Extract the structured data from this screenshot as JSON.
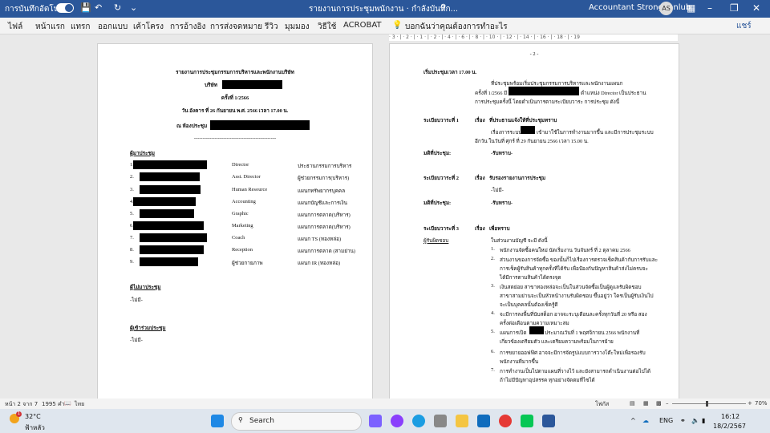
{
  "titlebar": {
    "autosave_label": "การบันทึกอัตโนมัติ",
    "document_title": "รายงานการประชุมพนักงาน · กำลังบันทึก...",
    "search_hint": "ค้นหา",
    "user_name": "Accountant Strongponlub",
    "avatar_initials": "AS"
  },
  "ribbon": {
    "tabs": [
      "ไฟล์",
      "หน้าแรก",
      "แทรก",
      "ออกแบบ",
      "เค้าโครง",
      "การอ้างอิง",
      "การส่งจดหมาย",
      "รีวิว",
      "มุมมอง",
      "วิธีใช้",
      "ACROBAT"
    ],
    "tell_me": "บอกฉันว่าคุณต้องการทำอะไร",
    "share_label": "แชร์"
  },
  "ruler_text": "· 3 · | · 2 · | · 1 · | · 2 · | · 4 · | · 6 · | · 8 · | · 10 · | · 12 · | · 14 · | · 16 · | · 18 · | · 19",
  "page1": {
    "title": "รายงานการประชุมกรรมการบริหารและพนักงานบริษัท",
    "company_label": "บริษัท",
    "meeting_no": "ครั้งที่ 1/2566",
    "datetime": "วัน อังคาร ที่ 26 กันยายน พ.ศ. 2566 เวลา 17.00 น.",
    "room_label": "ณ ห้องประชุม",
    "divider": "------------------------------------------------",
    "attendees_heading": "ผู้มาประชุม",
    "attendees": [
      {
        "no": "1.",
        "role": "Director",
        "dept": "ประธานกรรมการบริหาร"
      },
      {
        "no": "2.",
        "role": "Asst. Director",
        "dept": "ผู้ช่วยกรรมการ(บริหาร)"
      },
      {
        "no": "3.",
        "role": "Human Resource",
        "dept": "แผนกทรัพยากรบุคคล"
      },
      {
        "no": "4.",
        "role": "Accounting",
        "dept": "แผนกบัญชีและการเงิน"
      },
      {
        "no": "5.",
        "role": "Graphic",
        "dept": "แผนกการตลาด(บริหาร)"
      },
      {
        "no": "6.",
        "role": "Marketing",
        "dept": "แผนกการตลาด(บริหาร)"
      },
      {
        "no": "7.",
        "role": "Coach",
        "dept": "แผนก TS (ทองหล่อ)"
      },
      {
        "no": "8.",
        "role": "Reception",
        "dept": "แผนกการตลาด (สามย่าน)"
      },
      {
        "no": "9.",
        "role": "ผู้ช่วยกายภาพ",
        "dept": "แผนก IR (ทองหล่อ)"
      }
    ],
    "absent_heading": "ผู้ไม่มาประชุม",
    "absent_value": "-ไม่มี-",
    "guests_heading": "ผู้เข้าร่วมประชุม",
    "guests_value": "-ไม่มี-"
  },
  "page2": {
    "page_no": "- 2 -",
    "start_time": "เริ่มประชุมเวลา 17.00 น.",
    "intro": [
      "ที่ประชุมพร้อมเริ่มประชุมกรรมการบริหารและพนักงานแผนก",
      "ครั้งที่ 1/2566 มี",
      "ตำแหน่ง Director เป็นประธาน",
      "การประชุมครั้งนี้ โดยดำเนินการตามระเบียบวาระ การประชุม ดังนี้"
    ],
    "agenda": [
      {
        "title": "ระเบียบวาระที่ 1",
        "subject_label": "เรื่อง",
        "subject": "ที่ประธานแจ้งให้ที่ประชุมทราบ",
        "body": [
          "เรื่องการระบบ",
          "เข้ามาใช้ในการทำงานมากขึ้น และมีการประชุมระบบ",
          "อีกวัน ในวันที่ ศุกร์ ที่ 29 กันยายน 2566 เวลา 15.00 น."
        ],
        "resolution_label": "มติที่ประชุม:",
        "resolution": "-รับทราบ-"
      },
      {
        "title": "ระเบียบวาระที่ 2",
        "subject_label": "เรื่อง",
        "subject": "รับรองรายงานการประชุม",
        "body": [
          "-ไม่มี-"
        ],
        "resolution_label": "มติที่ประชุม:",
        "resolution": "-รับทราบ-"
      },
      {
        "title": "ระเบียบวาระที่ 3",
        "subject_label": "เรื่อง",
        "subject": "เพื่อทราบ"
      }
    ],
    "detail_label": "ผู้รับผิดชอบ",
    "detail_intro": "ในส่วนงานบัญชี จะมี ดังนี้",
    "items": [
      [
        "1.",
        "พนักงานจัดซื้อคนใหม่ นัดเริ่มงาน วันจันทร์ ที่ 2 ตุลาคม 2566"
      ],
      [
        "2.",
        "ส่วนงานของการจัดซื้อ ของนั้นก็ไปเรื่องการตรวจเช็คสินค้ากับการรับและ",
        "การเช็คผู้รับสินค้าทุกครั้งที่ได้รับ เพื่อป้องกันปัญหาสินค้าส่งไม่ครบจะ",
        "ได้มีการตามสินค้าได้ตรงจุด"
      ],
      [
        "3.",
        "เงินสดย่อย สาขาทองหล่อจะเป็นในส่วนจัดซื้อเป็นผู้ดูแลรับผิดชอบ",
        "สาขาสามย่านจะเป็นหัวหน้างานรับผิดชอบ ขึ้นอยู่ว่า ใครเป็นผู้รับเงินไป",
        "จะเป็นบุคคลนั้นต้องเช็ครู้ดี"
      ],
      [
        "4.",
        "จะมีการลงพื้นที่นับสต็อก อาจจะระบุเดือนละครั้งทุกวันที่ 20 หรือ สอง",
        "ครั้งต่อเดือนตามความเหมาะสม"
      ],
      [
        "5.",
        "แผนการเปิด",
        "ประมาณวันที่ 1 พฤศจิกายน 2566 พนักงานที่",
        "เกี่ยวข้องเตรียมตัว และเตรียมความพร้อมในการย้าย"
      ],
      [
        "6.",
        "การขยายออฟฟิศ อาจจะมีการจัดรูปแบบการวางโต๊ะใหม่เพื่อรองรับ",
        "พนักงานที่มากขึ้น"
      ],
      [
        "7.",
        "การทำงานเป็นไปตามแผนที่วางไว้ และยังสามารถดำเนินงานต่อไปได้",
        "ถ้าไม่มีปัญหาอุปสรรค ทุกอย่างจัดตมที่ไซได้"
      ]
    ]
  },
  "statusbar": {
    "page_info": "หน้า 2 จาก 7",
    "word_count": "1995 คำ",
    "focus": "โฟกัส",
    "zoom": "70%",
    "tools": "ไทย"
  },
  "taskbar": {
    "temperature": "32°C",
    "weather_text": "ฟ้าหลัว",
    "weather_badge": "1",
    "search_placeholder": "Search",
    "language": "ENG",
    "time": "16:12",
    "date": "18/2/2567"
  }
}
